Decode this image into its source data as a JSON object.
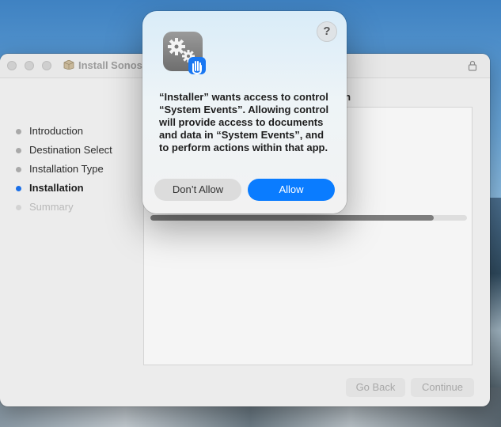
{
  "window": {
    "title": "Install Sonos",
    "partial_heading": "ation"
  },
  "steps": [
    {
      "label": "Introduction",
      "state": "done"
    },
    {
      "label": "Destination Select",
      "state": "done"
    },
    {
      "label": "Installation Type",
      "state": "done"
    },
    {
      "label": "Installation",
      "state": "active"
    },
    {
      "label": "Summary",
      "state": "pending"
    }
  ],
  "progress": {
    "fraction": 0.895
  },
  "buttons": {
    "go_back": "Go Back",
    "continue": "Continue"
  },
  "dialog": {
    "help": "?",
    "message": "“Installer” wants access to control “System Events”. Allowing control will provide access to documents and data in “System Events”, and to perform actions within that app.",
    "deny_label": "Don’t Allow",
    "allow_label": "Allow",
    "icon": "automation-gears-hand-icon"
  },
  "colors": {
    "accent": "#0a7cff",
    "active_step": "#1a6fe8"
  }
}
